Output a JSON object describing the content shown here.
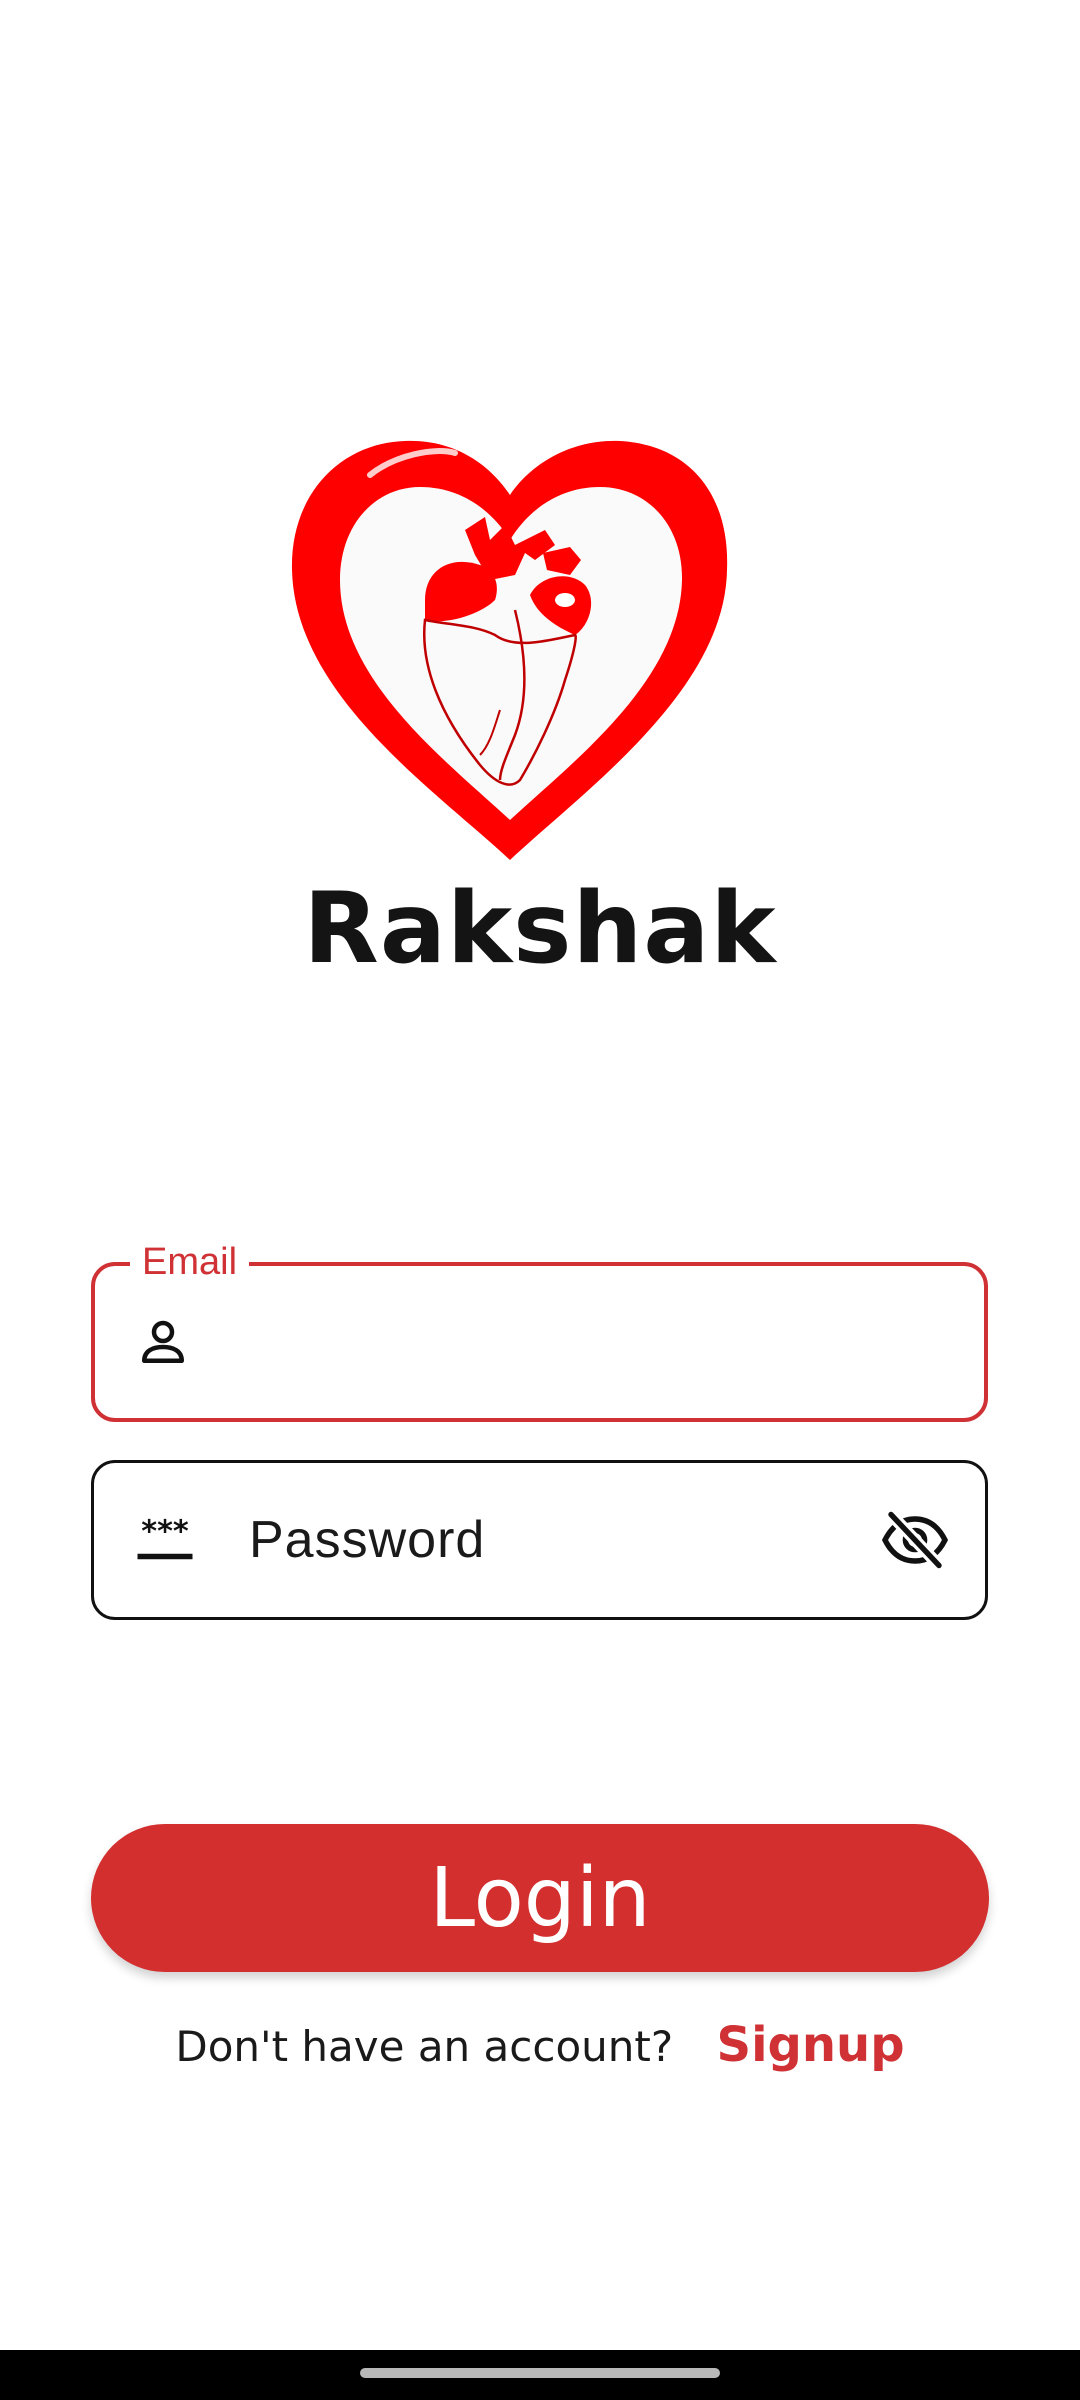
{
  "app": {
    "name": "Rakshak",
    "logo_icon": "heart-logo-icon",
    "brand_color": "#ff0000"
  },
  "form": {
    "email": {
      "label": "Email",
      "value": "",
      "icon": "person-icon"
    },
    "password": {
      "placeholder": "Password",
      "value": "",
      "icon": "password-icon",
      "toggle_icon": "eye-off-icon"
    }
  },
  "actions": {
    "login_label": "Login",
    "signup_prompt": "Don't have an account?",
    "signup_label": "Signup"
  },
  "colors": {
    "accent": "#cf3134",
    "button": "#d32f2f"
  }
}
